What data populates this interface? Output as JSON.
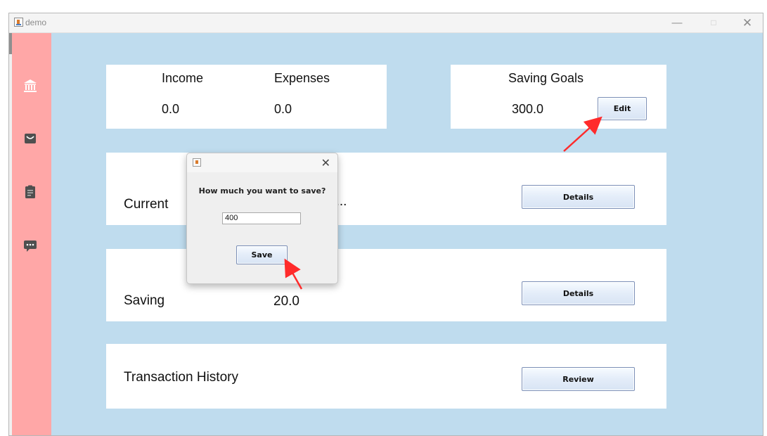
{
  "window": {
    "title": "demo"
  },
  "window_controls": {
    "minimize": "—",
    "maximize": "□",
    "close": "✕"
  },
  "sidebar": {
    "items": [
      {
        "icon": "bank-icon"
      },
      {
        "icon": "wallet-icon"
      },
      {
        "icon": "clipboard-icon"
      },
      {
        "icon": "chat-icon"
      }
    ]
  },
  "summary": {
    "income_label": "Income",
    "income_value": "0.0",
    "expenses_label": "Expenses",
    "expenses_value": "0.0"
  },
  "goals": {
    "label": "Saving Goals",
    "value": "300.0",
    "edit_button": "Edit"
  },
  "current": {
    "label": "Current",
    "value_truncated": "7...",
    "details_button": "Details"
  },
  "saving": {
    "label": "Saving",
    "value": "20.0",
    "details_button": "Details"
  },
  "history": {
    "label": "Transaction History",
    "review_button": "Review"
  },
  "dialog": {
    "close": "✕",
    "question": "How much you want to save?",
    "input_value": "400",
    "save_button": "Save"
  },
  "colors": {
    "sidebar": "#ffa7a7",
    "content": "#bfdcee",
    "card": "#ffffff",
    "annotation_arrow": "#ff2b2b"
  }
}
